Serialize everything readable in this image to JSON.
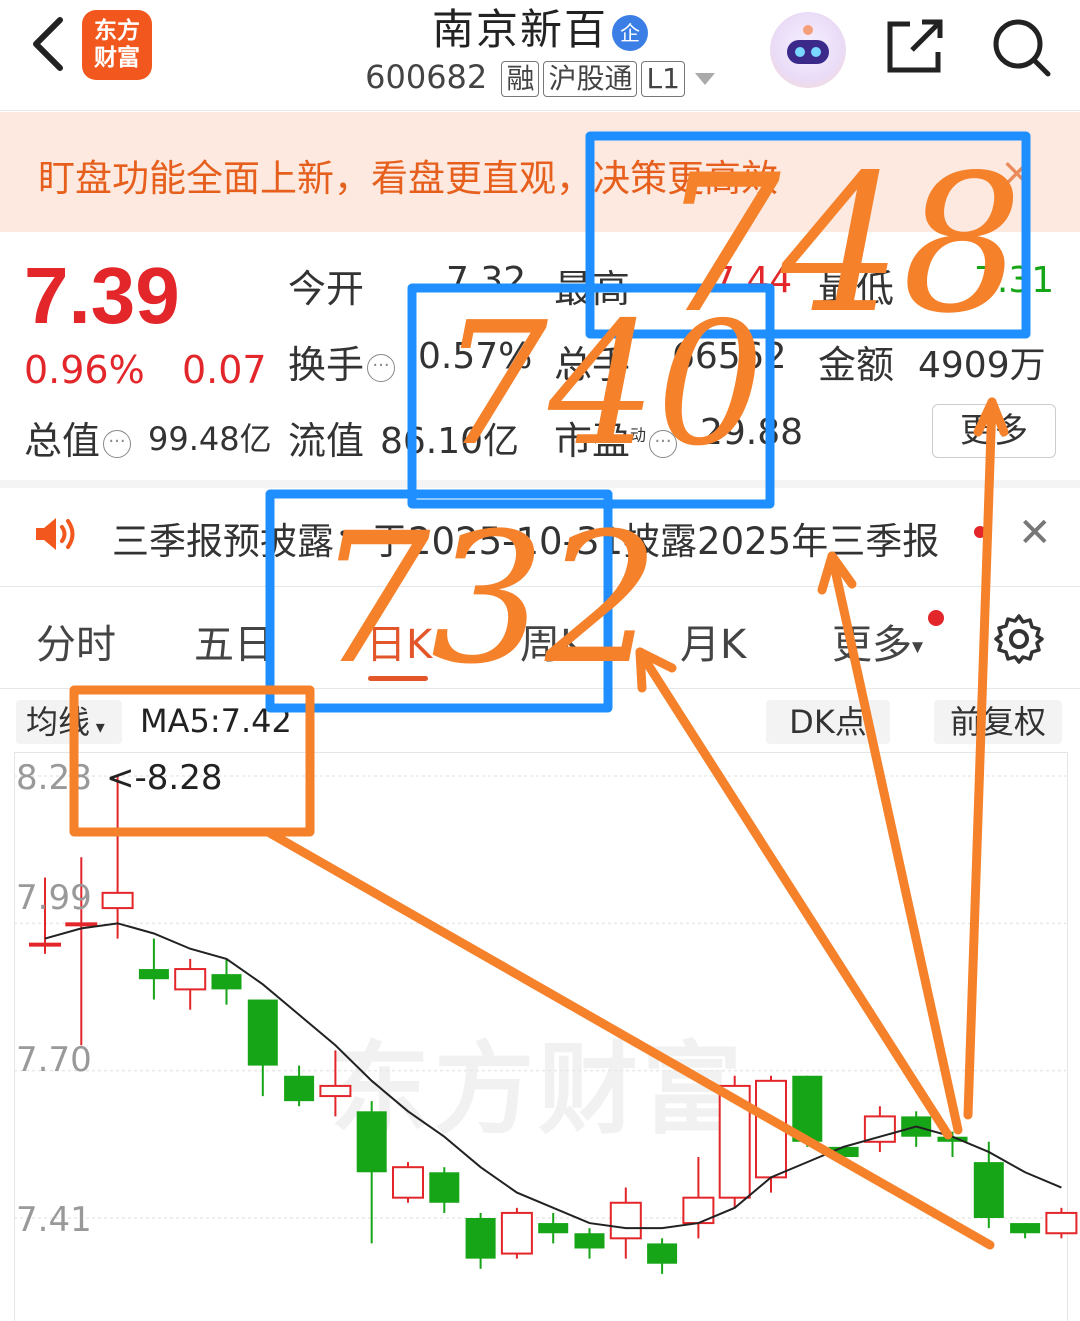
{
  "header": {
    "logo_line1": "东方",
    "logo_line2": "财富",
    "stock_name": "南京新百",
    "enterprise_badge": "企",
    "stock_code": "600682",
    "tags": [
      "融",
      "沪股通",
      "L1"
    ],
    "icons": [
      "back-icon",
      "robot-avatar",
      "share-icon",
      "search-icon"
    ]
  },
  "banner": {
    "text": "盯盘功能全面上新，看盘更直观，决策更高效",
    "close": "×"
  },
  "quote": {
    "price": "7.39",
    "change_pct": "0.96%",
    "change": "0.07",
    "open_label": "今开",
    "open": "7.32",
    "high_label": "最高",
    "high": "7.44",
    "low_label": "最低",
    "low": "7.31",
    "turnover_label": "换手",
    "turnover": "0.57%",
    "volume_label": "总手",
    "volume": "66562",
    "amount_label": "金额",
    "amount": "4909万",
    "mktcap_label": "总值",
    "mktcap": "99.48亿",
    "float_label": "流值",
    "float_cap": "86.10亿",
    "pe_label": "市盈",
    "pe_sub": "动",
    "pe": "29.88",
    "more": "更多",
    "colors": {
      "up": "#e2262a",
      "down": "#16a516"
    }
  },
  "notice": {
    "text": "三季报预披露：于2025-10-31披露2025年三季报"
  },
  "tabs": {
    "items": [
      "分时",
      "五日",
      "日K",
      "周K",
      "月K",
      "更多"
    ],
    "active": "日K"
  },
  "chart_toolbar": {
    "ma_select": "均线",
    "ma5": "MA5:7.42",
    "dk": "DK点",
    "fq": "前复权"
  },
  "chart_data": {
    "type": "candlestick",
    "y_ticks": [
      "8.28",
      "7.99",
      "7.70",
      "7.41"
    ],
    "max_label": "<-8.28",
    "watermark": "东方财富",
    "ma5_value": "7.42",
    "candles": [
      {
        "o": 7.95,
        "c": 7.95,
        "h": 8.08,
        "l": 7.93
      },
      {
        "o": 7.99,
        "c": 7.99,
        "h": 8.12,
        "l": 7.75
      },
      {
        "o": 8.02,
        "c": 8.05,
        "h": 8.28,
        "l": 7.96
      },
      {
        "o": 7.9,
        "c": 7.88,
        "h": 7.96,
        "l": 7.84
      },
      {
        "o": 7.86,
        "c": 7.9,
        "h": 7.92,
        "l": 7.82
      },
      {
        "o": 7.89,
        "c": 7.86,
        "h": 7.92,
        "l": 7.83
      },
      {
        "o": 7.84,
        "c": 7.71,
        "h": 7.84,
        "l": 7.65
      },
      {
        "o": 7.69,
        "c": 7.64,
        "h": 7.71,
        "l": 7.63
      },
      {
        "o": 7.65,
        "c": 7.67,
        "h": 7.74,
        "l": 7.61
      },
      {
        "o": 7.62,
        "c": 7.5,
        "h": 7.64,
        "l": 7.36
      },
      {
        "o": 7.45,
        "c": 7.51,
        "h": 7.52,
        "l": 7.44
      },
      {
        "o": 7.5,
        "c": 7.44,
        "h": 7.51,
        "l": 7.42
      },
      {
        "o": 7.41,
        "c": 7.33,
        "h": 7.42,
        "l": 7.31
      },
      {
        "o": 7.34,
        "c": 7.42,
        "h": 7.43,
        "l": 7.33
      },
      {
        "o": 7.4,
        "c": 7.38,
        "h": 7.42,
        "l": 7.36
      },
      {
        "o": 7.38,
        "c": 7.35,
        "h": 7.39,
        "l": 7.33
      },
      {
        "o": 7.37,
        "c": 7.44,
        "h": 7.47,
        "l": 7.33
      },
      {
        "o": 7.36,
        "c": 7.32,
        "h": 7.37,
        "l": 7.3
      },
      {
        "o": 7.4,
        "c": 7.45,
        "h": 7.53,
        "l": 7.37
      },
      {
        "o": 7.45,
        "c": 7.67,
        "h": 7.69,
        "l": 7.43
      },
      {
        "o": 7.49,
        "c": 7.68,
        "h": 7.69,
        "l": 7.46
      },
      {
        "o": 7.69,
        "c": 7.56,
        "h": 7.69,
        "l": 7.55
      },
      {
        "o": 7.55,
        "c": 7.53,
        "h": 7.55,
        "l": 7.52
      },
      {
        "o": 7.56,
        "c": 7.61,
        "h": 7.63,
        "l": 7.54
      },
      {
        "o": 7.61,
        "c": 7.57,
        "h": 7.62,
        "l": 7.55
      },
      {
        "o": 7.57,
        "c": 7.56,
        "h": 7.58,
        "l": 7.53
      },
      {
        "o": 7.52,
        "c": 7.41,
        "h": 7.56,
        "l": 7.39
      },
      {
        "o": 7.4,
        "c": 7.38,
        "h": 7.4,
        "l": 7.37
      },
      {
        "o": 7.38,
        "c": 7.42,
        "h": 7.43,
        "l": 7.37
      }
    ],
    "ma5": [
      7.96,
      7.98,
      7.99,
      7.97,
      7.94,
      7.92,
      7.87,
      7.81,
      7.75,
      7.68,
      7.62,
      7.57,
      7.51,
      7.46,
      7.43,
      7.4,
      7.39,
      7.39,
      7.4,
      7.43,
      7.49,
      7.52,
      7.55,
      7.57,
      7.59,
      7.57,
      7.54,
      7.5,
      7.47
    ]
  },
  "annotations": {
    "labels": [
      "748",
      "740",
      "732"
    ]
  }
}
